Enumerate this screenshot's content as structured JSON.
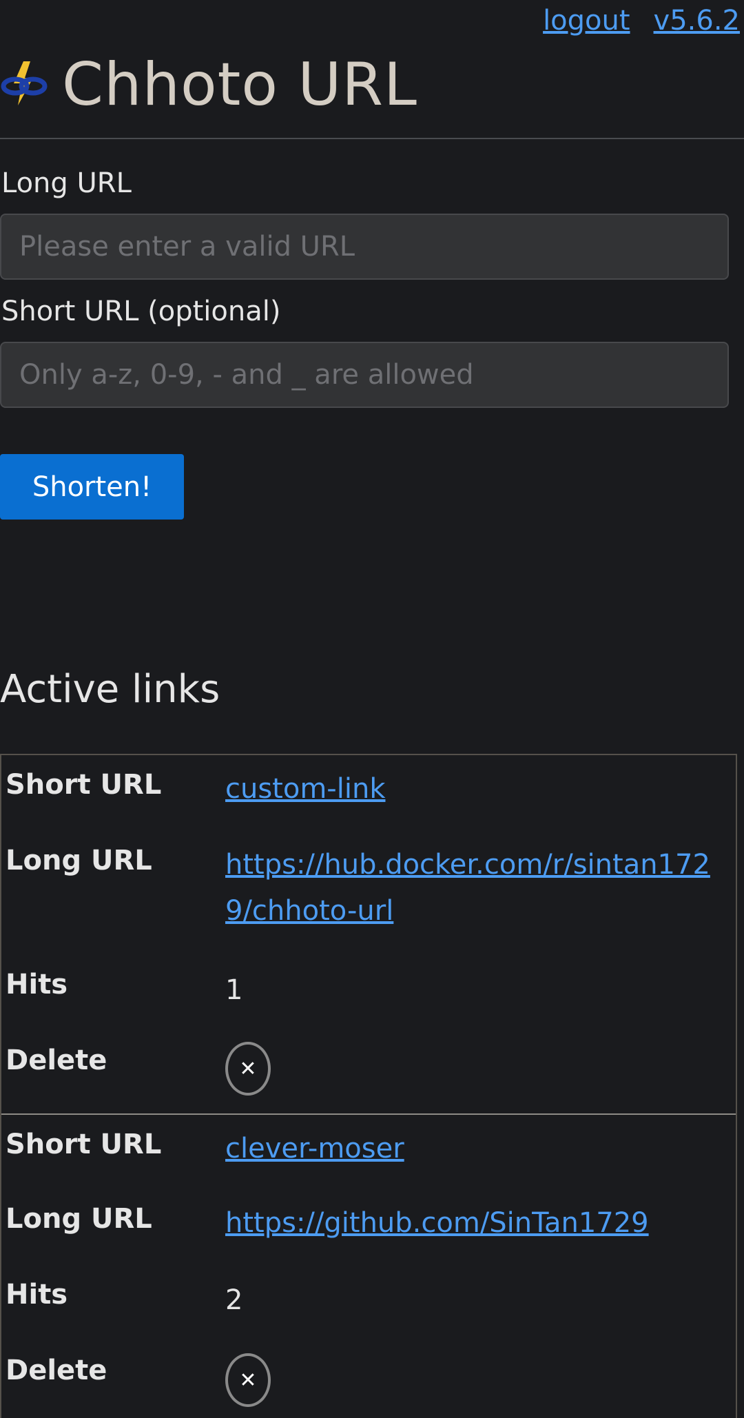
{
  "topbar": {
    "logout_label": "logout",
    "version_label": "v5.6.2"
  },
  "header": {
    "title": "Chhoto URL",
    "logo_icon": "chain-link-lightning-icon"
  },
  "form": {
    "long_url_label": "Long URL",
    "long_url_placeholder": "Please enter a valid URL",
    "long_url_value": "",
    "short_url_label": "Short URL (optional)",
    "short_url_placeholder": "Only a-z, 0-9, - and _ are allowed",
    "short_url_value": "",
    "submit_label": "Shorten!"
  },
  "links_section": {
    "title": "Active links",
    "keys": {
      "short": "Short URL",
      "long": "Long URL",
      "hits": "Hits",
      "delete": "Delete"
    },
    "delete_icon": "close-icon",
    "items": [
      {
        "short": "custom-link",
        "long": "https://hub.docker.com/r/sintan1729/chhoto-url",
        "hits": "1"
      },
      {
        "short": "clever-moser",
        "long": "https://github.com/SinTan1729",
        "hits": "2"
      }
    ]
  },
  "colors": {
    "background": "#1a1b1e",
    "link": "#4d9cf2",
    "button": "#0a6fd1",
    "input_bg": "#323335"
  }
}
